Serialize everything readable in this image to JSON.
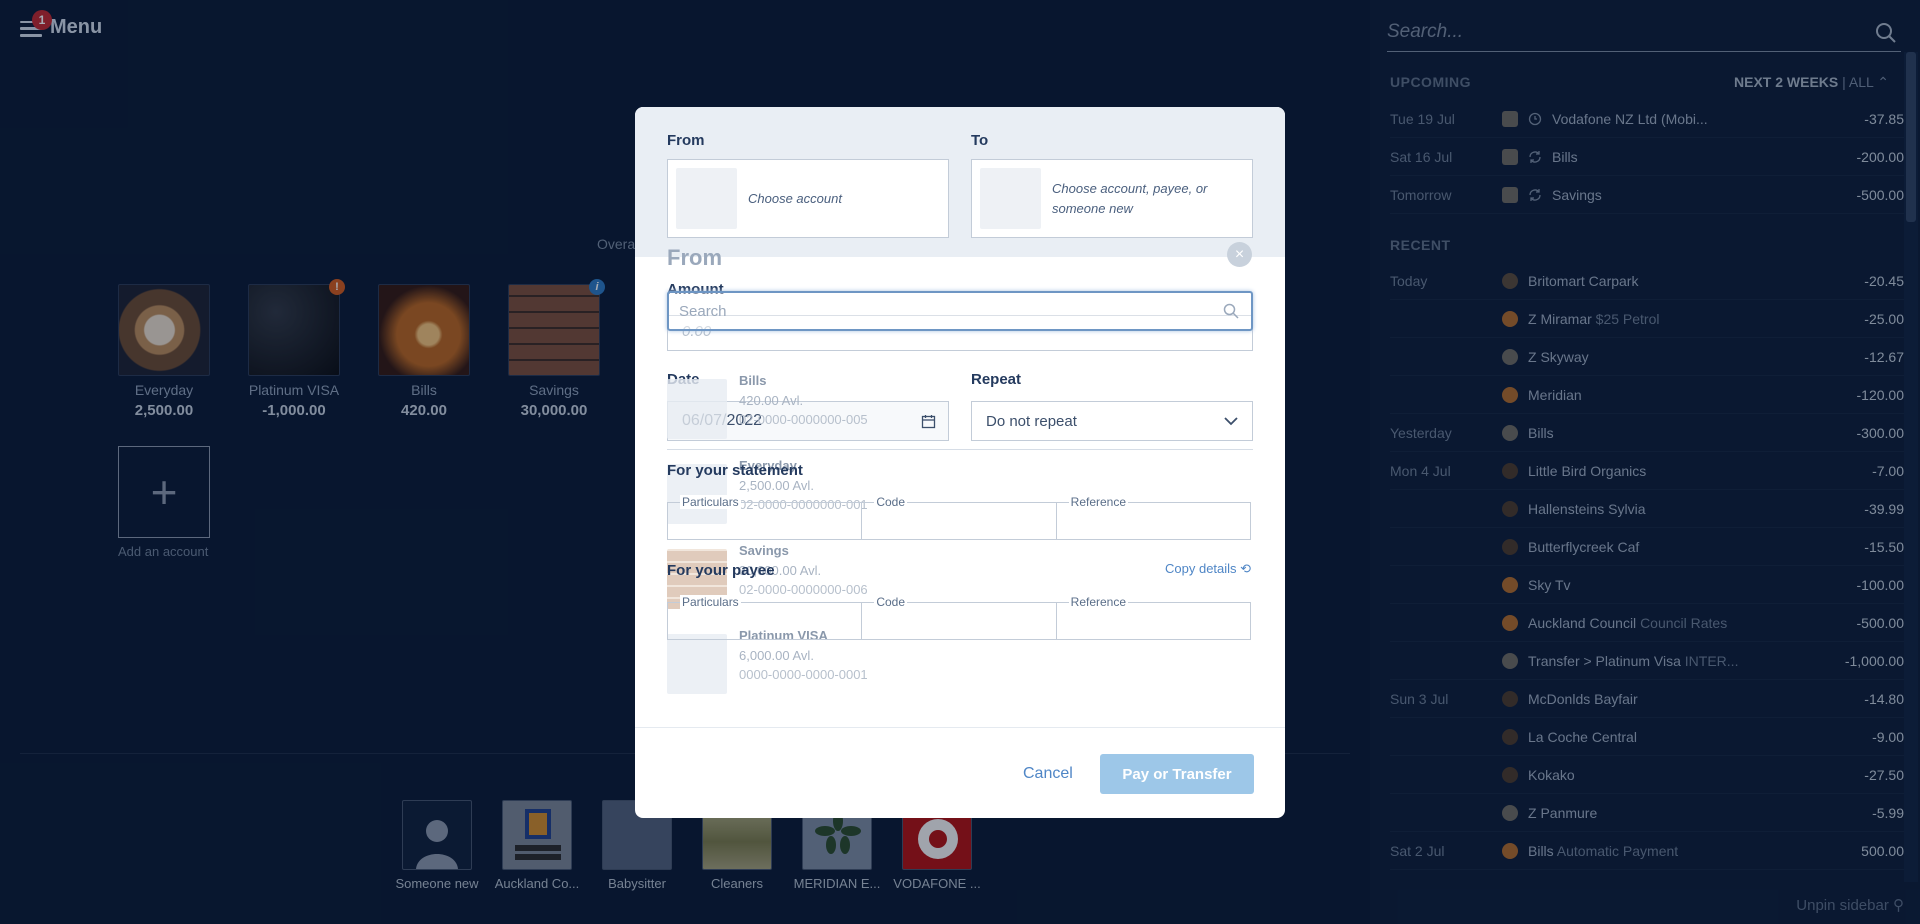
{
  "header": {
    "menu_label": "Menu",
    "notification_count": "1"
  },
  "overview": {
    "label": "Overa"
  },
  "accounts": [
    {
      "name": "Everyday",
      "balance": "2,500.00"
    },
    {
      "name": "Platinum VISA",
      "balance": "-1,000.00",
      "badge": "!"
    },
    {
      "name": "Bills",
      "balance": "420.00"
    },
    {
      "name": "Savings",
      "balance": "30,000.00",
      "badge": "i"
    }
  ],
  "add_account": {
    "icon_text": "+",
    "label": "Add an account"
  },
  "payees": [
    {
      "name": "Someone new"
    },
    {
      "name": "Auckland Co..."
    },
    {
      "name": "Babysitter"
    },
    {
      "name": "Cleaners"
    },
    {
      "name": "MERIDIAN E..."
    },
    {
      "name": "VODAFONE ..."
    }
  ],
  "sidebar": {
    "search_placeholder": "Search...",
    "upcoming_title": "UPCOMING",
    "filter_next": "NEXT 2 WEEKS",
    "filter_sep": "|",
    "filter_all": "ALL",
    "recent_title": "RECENT",
    "upcoming": [
      {
        "date": "Tue 19 Jul",
        "desc": "Vodafone NZ Ltd (Mobi...",
        "sub": "",
        "amount": "-37.85",
        "kind": "clock-icon"
      },
      {
        "date": "Sat 16 Jul",
        "desc": "Bills",
        "sub": "",
        "amount": "-200.00",
        "kind": "repeat-icon"
      },
      {
        "date": "Tomorrow",
        "desc": "Savings",
        "sub": "",
        "amount": "-500.00",
        "kind": "repeat-icon"
      }
    ],
    "recent": [
      {
        "date": "Today",
        "desc": "Britomart Carpark",
        "sub": "",
        "amount": "-20.45"
      },
      {
        "date": "",
        "desc": "Z Miramar",
        "sub": "$25 Petrol",
        "amount": "-25.00"
      },
      {
        "date": "",
        "desc": "Z Skyway",
        "sub": "",
        "amount": "-12.67"
      },
      {
        "date": "",
        "desc": "Meridian",
        "sub": "",
        "amount": "-120.00"
      },
      {
        "date": "Yesterday",
        "desc": "Bills",
        "sub": "",
        "amount": "-300.00"
      },
      {
        "date": "Mon 4 Jul",
        "desc": "Little Bird Organics",
        "sub": "",
        "amount": "-7.00"
      },
      {
        "date": "",
        "desc": "Hallensteins Sylvia",
        "sub": "",
        "amount": "-39.99"
      },
      {
        "date": "",
        "desc": "Butterflycreek Caf",
        "sub": "",
        "amount": "-15.50"
      },
      {
        "date": "",
        "desc": "Sky Tv",
        "sub": "",
        "amount": "-100.00"
      },
      {
        "date": "",
        "desc": "Auckland Council",
        "sub": "Council Rates",
        "amount": "-500.00"
      },
      {
        "date": "",
        "desc": "Transfer > Platinum Visa",
        "sub": "INTER...",
        "amount": "-1,000.00"
      },
      {
        "date": "Sun 3 Jul",
        "desc": "McDonlds Bayfair",
        "sub": "",
        "amount": "-14.80"
      },
      {
        "date": "",
        "desc": "La Coche Central",
        "sub": "",
        "amount": "-9.00"
      },
      {
        "date": "",
        "desc": "Kokako",
        "sub": "",
        "amount": "-27.50"
      },
      {
        "date": "",
        "desc": "Z Panmure",
        "sub": "",
        "amount": "-5.99"
      },
      {
        "date": "Sat 2 Jul",
        "desc": "Bills",
        "sub": "Automatic Payment",
        "amount": "500.00"
      }
    ],
    "unpin_label": "Unpin sidebar"
  },
  "modal": {
    "from_label": "From",
    "from_placeholder": "Choose account",
    "to_label": "To",
    "to_placeholder": "Choose account, payee, or someone new",
    "ghost_from_title": "From",
    "ghost_close": "×",
    "search_placeholder": "Search",
    "amount_label": "Amount",
    "amount_placeholder": "0.00",
    "date_label": "Date",
    "date_value": "06/07/2022",
    "repeat_label": "Repeat",
    "repeat_value": "Do not repeat",
    "statement_title": "For your statement",
    "statement_fields": [
      "Particulars",
      "Code",
      "Reference"
    ],
    "payee_title": "For your payee",
    "copy_details": "Copy details",
    "payee_fields": [
      "Particulars",
      "Code",
      "Reference"
    ],
    "ghost_accounts": [
      {
        "name": "Bills",
        "avail": "420.00 Avl.",
        "number": "02-0000-0000000-005"
      },
      {
        "name": "Everyday",
        "avail": "2,500.00 Avl.",
        "number": "02-0000-0000000-001"
      },
      {
        "name": "Savings",
        "avail": "30,000.00 Avl.",
        "number": "02-0000-0000000-006"
      },
      {
        "name": "Platinum VISA",
        "avail": "6,000.00 Avl.",
        "number": "0000-0000-0000-0001"
      }
    ],
    "cancel_label": "Cancel",
    "submit_label": "Pay or Transfer"
  },
  "colors": {
    "background": "#0a1a33",
    "sidebar": "#0d1d37",
    "accent": "#4f86c6",
    "submit_disabled": "#9dc7e8",
    "notification": "#c0272d"
  }
}
